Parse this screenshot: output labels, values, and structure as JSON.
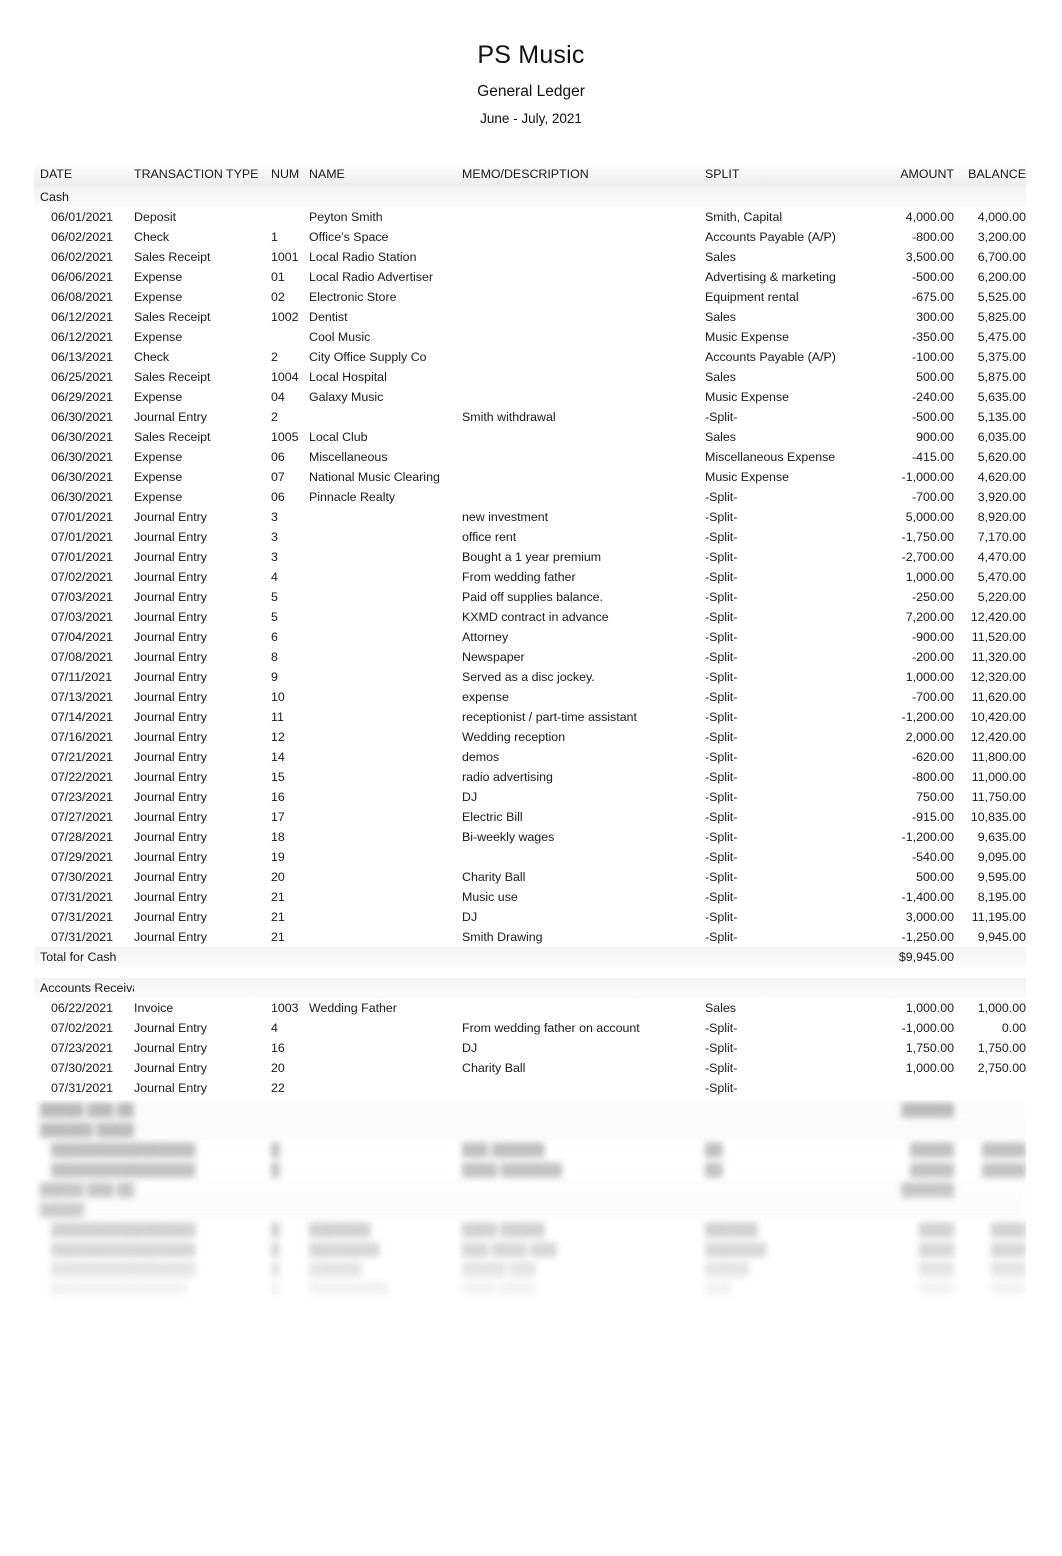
{
  "report": {
    "company": "PS Music",
    "title": "General Ledger",
    "period": "June - July, 2021"
  },
  "columns": {
    "date": "DATE",
    "transaction_type": "TRANSACTION TYPE",
    "num": "NUM",
    "name": "NAME",
    "memo": "MEMO/DESCRIPTION",
    "split": "SPLIT",
    "amount": "AMOUNT",
    "balance": "BALANCE"
  },
  "sections": [
    {
      "account": "Cash",
      "total_label": "Total for Cash",
      "total_amount": "$9,945.00",
      "rows": [
        {
          "date": "06/01/2021",
          "type": "Deposit",
          "num": "",
          "name": "Peyton Smith",
          "memo": "",
          "split": "Smith, Capital",
          "amount": "4,000.00",
          "balance": "4,000.00"
        },
        {
          "date": "06/02/2021",
          "type": "Check",
          "num": "1",
          "name": "Office’s Space",
          "memo": "",
          "split": "Accounts Payable (A/P)",
          "amount": "-800.00",
          "balance": "3,200.00"
        },
        {
          "date": "06/02/2021",
          "type": "Sales Receipt",
          "num": "1001",
          "name": "Local Radio Station",
          "memo": "",
          "split": "Sales",
          "amount": "3,500.00",
          "balance": "6,700.00"
        },
        {
          "date": "06/06/2021",
          "type": "Expense",
          "num": "01",
          "name": "Local Radio Advertiser",
          "memo": "",
          "split": "Advertising & marketing",
          "amount": "-500.00",
          "balance": "6,200.00"
        },
        {
          "date": "06/08/2021",
          "type": "Expense",
          "num": "02",
          "name": "Electronic Store",
          "memo": "",
          "split": "Equipment rental",
          "amount": "-675.00",
          "balance": "5,525.00"
        },
        {
          "date": "06/12/2021",
          "type": "Sales Receipt",
          "num": "1002",
          "name": "Dentist",
          "memo": "",
          "split": "Sales",
          "amount": "300.00",
          "balance": "5,825.00"
        },
        {
          "date": "06/12/2021",
          "type": "Expense",
          "num": "",
          "name": "Cool Music",
          "memo": "",
          "split": "Music Expense",
          "amount": "-350.00",
          "balance": "5,475.00"
        },
        {
          "date": "06/13/2021",
          "type": "Check",
          "num": "2",
          "name": "City Office Supply Co",
          "memo": "",
          "split": "Accounts Payable (A/P)",
          "amount": "-100.00",
          "balance": "5,375.00"
        },
        {
          "date": "06/25/2021",
          "type": "Sales Receipt",
          "num": "1004",
          "name": "Local Hospital",
          "memo": "",
          "split": "Sales",
          "amount": "500.00",
          "balance": "5,875.00"
        },
        {
          "date": "06/29/2021",
          "type": "Expense",
          "num": "04",
          "name": "Galaxy Music",
          "memo": "",
          "split": "Music Expense",
          "amount": "-240.00",
          "balance": "5,635.00"
        },
        {
          "date": "06/30/2021",
          "type": "Journal Entry",
          "num": "2",
          "name": "",
          "memo": "Smith withdrawal",
          "split": "-Split-",
          "amount": "-500.00",
          "balance": "5,135.00"
        },
        {
          "date": "06/30/2021",
          "type": "Sales Receipt",
          "num": "1005",
          "name": "Local Club",
          "memo": "",
          "split": "Sales",
          "amount": "900.00",
          "balance": "6,035.00"
        },
        {
          "date": "06/30/2021",
          "type": "Expense",
          "num": "06",
          "name": "Miscellaneous",
          "memo": "",
          "split": "Miscellaneous Expense",
          "amount": "-415.00",
          "balance": "5,620.00"
        },
        {
          "date": "06/30/2021",
          "type": "Expense",
          "num": "07",
          "name": "National Music Clearing",
          "memo": "",
          "split": "Music Expense",
          "amount": "-1,000.00",
          "balance": "4,620.00"
        },
        {
          "date": "06/30/2021",
          "type": "Expense",
          "num": "06",
          "name": "Pinnacle Realty",
          "memo": "",
          "split": "-Split-",
          "amount": "-700.00",
          "balance": "3,920.00"
        },
        {
          "date": "07/01/2021",
          "type": "Journal Entry",
          "num": "3",
          "name": "",
          "memo": "new investment",
          "split": "-Split-",
          "amount": "5,000.00",
          "balance": "8,920.00"
        },
        {
          "date": "07/01/2021",
          "type": "Journal Entry",
          "num": "3",
          "name": "",
          "memo": "office rent",
          "split": "-Split-",
          "amount": "-1,750.00",
          "balance": "7,170.00"
        },
        {
          "date": "07/01/2021",
          "type": "Journal Entry",
          "num": "3",
          "name": "",
          "memo": "Bought a 1 year premium",
          "split": "-Split-",
          "amount": "-2,700.00",
          "balance": "4,470.00"
        },
        {
          "date": "07/02/2021",
          "type": "Journal Entry",
          "num": "4",
          "name": "",
          "memo": "From wedding father",
          "split": "-Split-",
          "amount": "1,000.00",
          "balance": "5,470.00"
        },
        {
          "date": "07/03/2021",
          "type": "Journal Entry",
          "num": "5",
          "name": "",
          "memo": "Paid off supplies balance.",
          "split": "-Split-",
          "amount": "-250.00",
          "balance": "5,220.00"
        },
        {
          "date": "07/03/2021",
          "type": "Journal Entry",
          "num": "5",
          "name": "",
          "memo": "KXMD contract in advance",
          "split": "-Split-",
          "amount": "7,200.00",
          "balance": "12,420.00"
        },
        {
          "date": "07/04/2021",
          "type": "Journal Entry",
          "num": "6",
          "name": "",
          "memo": "Attorney",
          "split": "-Split-",
          "amount": "-900.00",
          "balance": "11,520.00"
        },
        {
          "date": "07/08/2021",
          "type": "Journal Entry",
          "num": "8",
          "name": "",
          "memo": "Newspaper",
          "split": "-Split-",
          "amount": "-200.00",
          "balance": "11,320.00"
        },
        {
          "date": "07/11/2021",
          "type": "Journal Entry",
          "num": "9",
          "name": "",
          "memo": "Served as a disc jockey.",
          "split": "-Split-",
          "amount": "1,000.00",
          "balance": "12,320.00"
        },
        {
          "date": "07/13/2021",
          "type": "Journal Entry",
          "num": "10",
          "name": "",
          "memo": "expense",
          "split": "-Split-",
          "amount": "-700.00",
          "balance": "11,620.00"
        },
        {
          "date": "07/14/2021",
          "type": "Journal Entry",
          "num": "11",
          "name": "",
          "memo": "receptionist / part-time assistant",
          "split": "-Split-",
          "amount": "-1,200.00",
          "balance": "10,420.00"
        },
        {
          "date": "07/16/2021",
          "type": "Journal Entry",
          "num": "12",
          "name": "",
          "memo": "Wedding reception",
          "split": "-Split-",
          "amount": "2,000.00",
          "balance": "12,420.00"
        },
        {
          "date": "07/21/2021",
          "type": "Journal Entry",
          "num": "14",
          "name": "",
          "memo": "demos",
          "split": "-Split-",
          "amount": "-620.00",
          "balance": "11,800.00"
        },
        {
          "date": "07/22/2021",
          "type": "Journal Entry",
          "num": "15",
          "name": "",
          "memo": "radio advertising",
          "split": "-Split-",
          "amount": "-800.00",
          "balance": "11,000.00"
        },
        {
          "date": "07/23/2021",
          "type": "Journal Entry",
          "num": "16",
          "name": "",
          "memo": "DJ",
          "split": "-Split-",
          "amount": "750.00",
          "balance": "11,750.00"
        },
        {
          "date": "07/27/2021",
          "type": "Journal Entry",
          "num": "17",
          "name": "",
          "memo": "Electric Bill",
          "split": "-Split-",
          "amount": "-915.00",
          "balance": "10,835.00"
        },
        {
          "date": "07/28/2021",
          "type": "Journal Entry",
          "num": "18",
          "name": "",
          "memo": "Bi-weekly wages",
          "split": "-Split-",
          "amount": "-1,200.00",
          "balance": "9,635.00"
        },
        {
          "date": "07/29/2021",
          "type": "Journal Entry",
          "num": "19",
          "name": "",
          "memo": "",
          "split": "-Split-",
          "amount": "-540.00",
          "balance": "9,095.00"
        },
        {
          "date": "07/30/2021",
          "type": "Journal Entry",
          "num": "20",
          "name": "",
          "memo": "Charity Ball",
          "split": "-Split-",
          "amount": "500.00",
          "balance": "9,595.00"
        },
        {
          "date": "07/31/2021",
          "type": "Journal Entry",
          "num": "21",
          "name": "",
          "memo": "Music use",
          "split": "-Split-",
          "amount": "-1,400.00",
          "balance": "8,195.00"
        },
        {
          "date": "07/31/2021",
          "type": "Journal Entry",
          "num": "21",
          "name": "",
          "memo": "DJ",
          "split": "-Split-",
          "amount": "3,000.00",
          "balance": "11,195.00"
        },
        {
          "date": "07/31/2021",
          "type": "Journal Entry",
          "num": "21",
          "name": "",
          "memo": "Smith Drawing",
          "split": "-Split-",
          "amount": "-1,250.00",
          "balance": "9,945.00"
        }
      ]
    },
    {
      "account": "Accounts Receivable (A/R)",
      "total_label": "",
      "total_amount": "",
      "rows": [
        {
          "date": "06/22/2021",
          "type": "Invoice",
          "num": "1003",
          "name": "Wedding Father",
          "memo": "",
          "split": "Sales",
          "amount": "1,000.00",
          "balance": "1,000.00"
        },
        {
          "date": "07/02/2021",
          "type": "Journal Entry",
          "num": "4",
          "name": "",
          "memo": "From wedding father on account",
          "split": "-Split-",
          "amount": "-1,000.00",
          "balance": "0.00"
        },
        {
          "date": "07/23/2021",
          "type": "Journal Entry",
          "num": "16",
          "name": "",
          "memo": "DJ",
          "split": "-Split-",
          "amount": "1,750.00",
          "balance": "1,750.00"
        },
        {
          "date": "07/30/2021",
          "type": "Journal Entry",
          "num": "20",
          "name": "",
          "memo": "Charity Ball",
          "split": "-Split-",
          "amount": "1,000.00",
          "balance": "2,750.00"
        },
        {
          "date": "07/31/2021",
          "type": "Journal Entry",
          "num": "22",
          "name": "",
          "memo": "",
          "split": "-Split-",
          "amount": "",
          "balance": ""
        }
      ]
    }
  ],
  "obscured_tail": {
    "note": "Lower portion of the page is blurred and illegible.",
    "rows": [
      {
        "date": "█████ ███ ██████████ █████████",
        "type": "",
        "num": "",
        "name": "",
        "memo": "",
        "split": "",
        "amount": "██████",
        "balance": ""
      },
      {
        "date": "██████ █████",
        "type": "",
        "num": "",
        "name": "",
        "memo": "",
        "split": "",
        "amount": "",
        "balance": ""
      },
      {
        "date": "██████████",
        "type": "███████",
        "num": "█",
        "name": "",
        "memo": "███ ██████",
        "split": "██",
        "amount": "█████",
        "balance": "█████"
      },
      {
        "date": "██████████",
        "type": "███████",
        "num": "█",
        "name": "",
        "memo": "████ ███████",
        "split": "██",
        "amount": "█████",
        "balance": "█████"
      },
      {
        "date": "█████ ███ ██████",
        "type": "",
        "num": "",
        "name": "",
        "memo": "",
        "split": "",
        "amount": "██████",
        "balance": ""
      },
      {
        "date": "█████",
        "type": "",
        "num": "",
        "name": "",
        "memo": "",
        "split": "",
        "amount": "",
        "balance": ""
      },
      {
        "date": "██████████",
        "type": "███████",
        "num": "█",
        "name": "███████",
        "memo": "████ █████",
        "split": "██████",
        "amount": "████",
        "balance": "████"
      },
      {
        "date": "██████████",
        "type": "███████",
        "num": "█",
        "name": "████████",
        "memo": "███ ████ ███",
        "split": "███████",
        "amount": "████",
        "balance": "████"
      },
      {
        "date": "██████████",
        "type": "███████",
        "num": "█",
        "name": "██████",
        "memo": "█████ ███",
        "split": "█████",
        "amount": "████",
        "balance": "████"
      },
      {
        "date": "██████████",
        "type": "██████",
        "num": "█",
        "name": "█████████",
        "memo": "████ ████",
        "split": "███",
        "amount": "████",
        "balance": "████"
      }
    ]
  }
}
